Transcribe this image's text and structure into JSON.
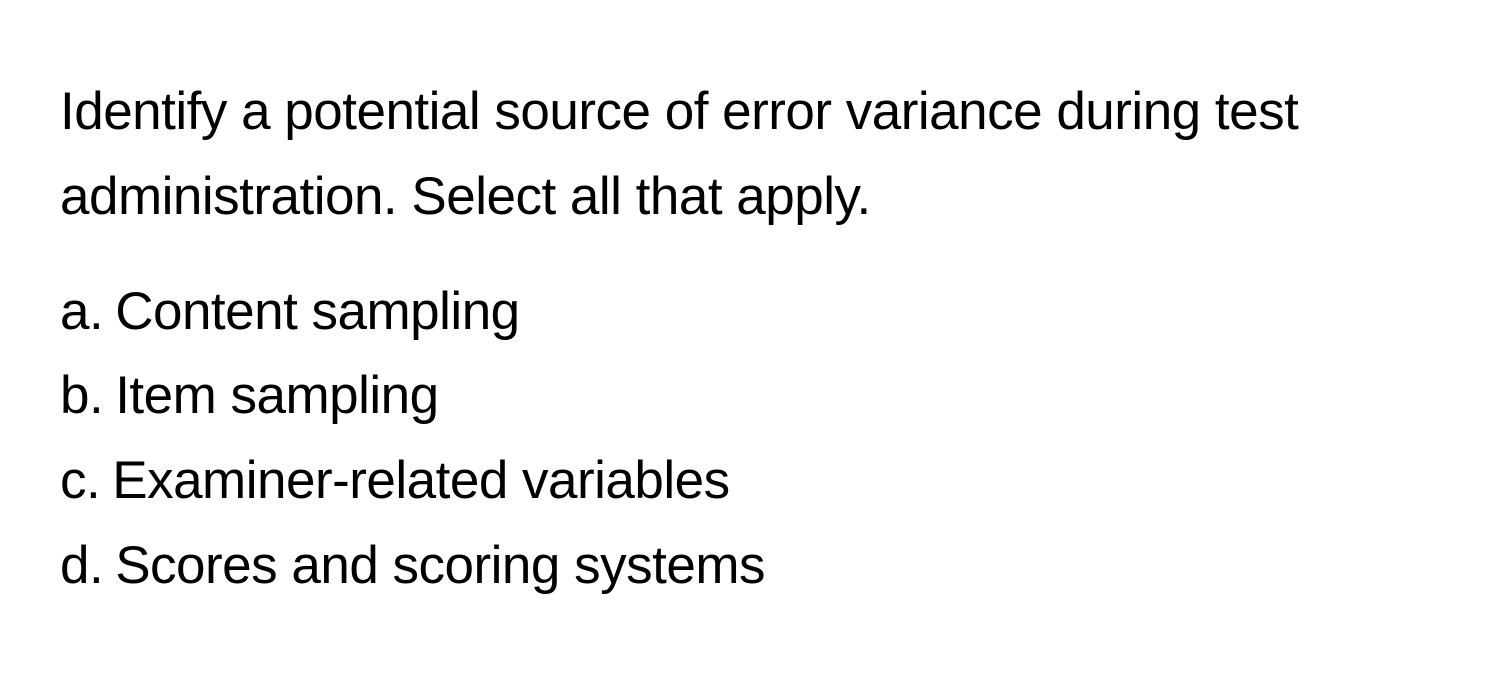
{
  "question": {
    "text": "Identify a potential source of error variance during test administration. Select all that apply."
  },
  "options": [
    {
      "letter": "a.",
      "text": "Content sampling"
    },
    {
      "letter": "b.",
      "text": "Item sampling"
    },
    {
      "letter": "c.",
      "text": "Examiner-related variables"
    },
    {
      "letter": "d.",
      "text": "Scores and scoring systems"
    }
  ]
}
